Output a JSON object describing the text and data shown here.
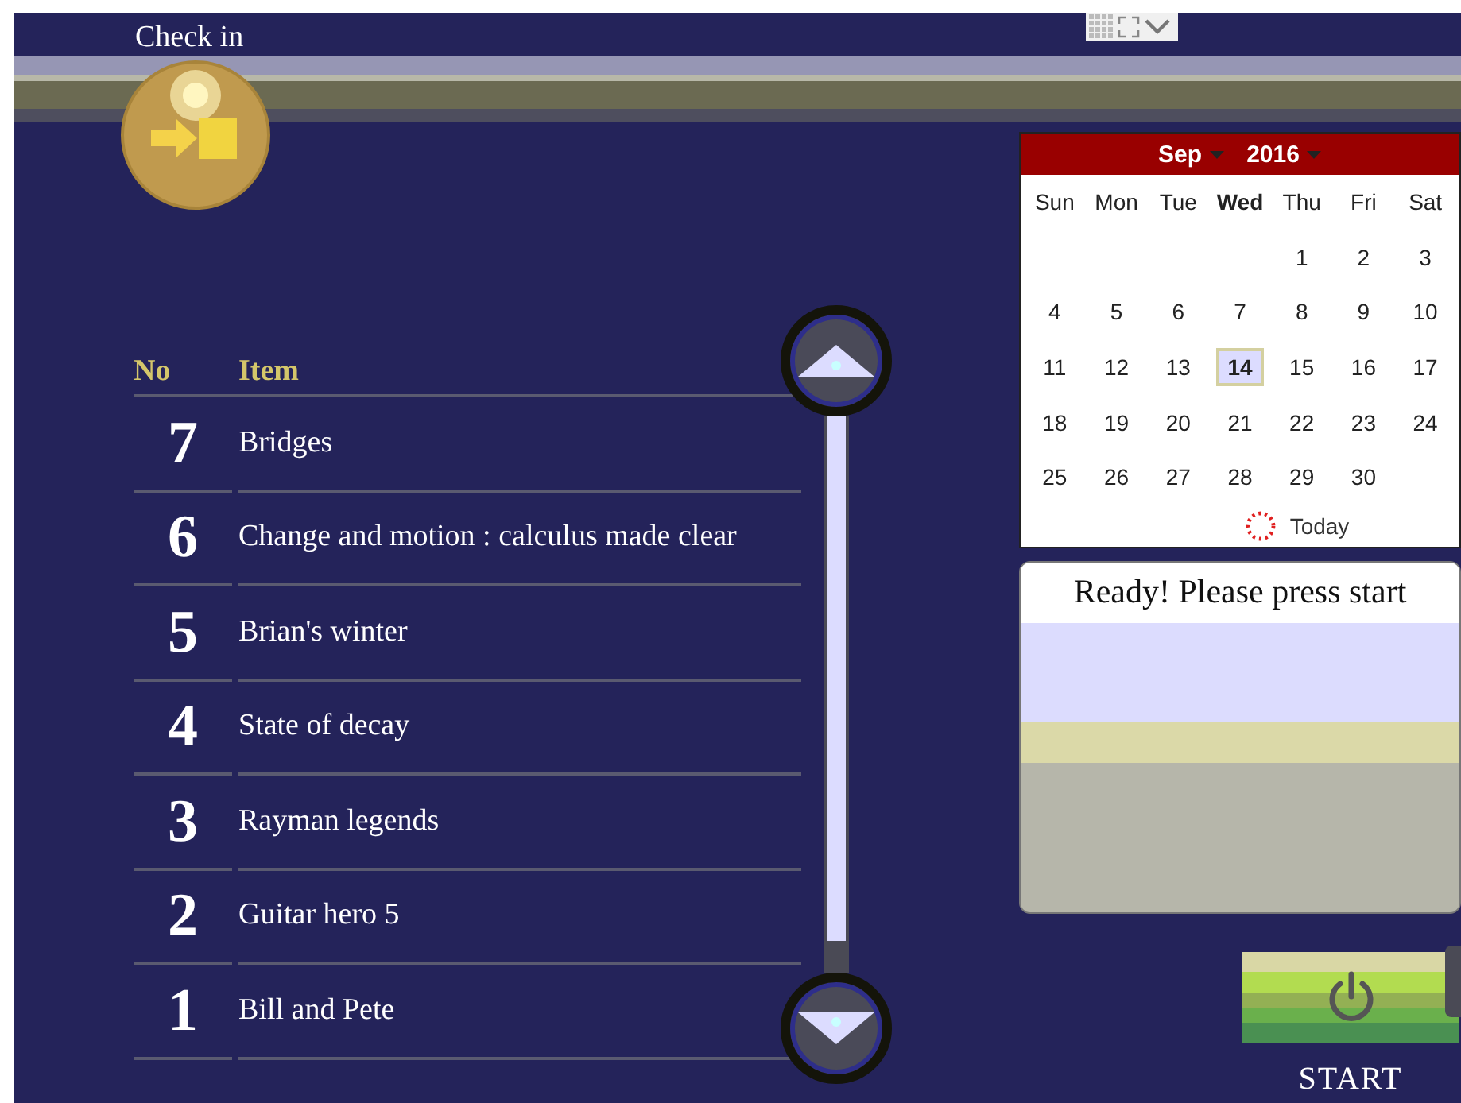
{
  "window": {
    "title": "Check in"
  },
  "list": {
    "columns": [
      "No",
      "Item"
    ],
    "rows": [
      {
        "no": "7",
        "item": "Bridges"
      },
      {
        "no": "6",
        "item": "Change and motion : calculus made clear"
      },
      {
        "no": "5",
        "item": "Brian's winter"
      },
      {
        "no": "4",
        "item": "State of decay"
      },
      {
        "no": "3",
        "item": "Rayman legends"
      },
      {
        "no": "2",
        "item": "Guitar hero 5"
      },
      {
        "no": "1",
        "item": "Bill and Pete"
      }
    ]
  },
  "calendar": {
    "month": "Sep",
    "year": "2016",
    "weekdays": [
      {
        "label": "Sun",
        "current": false
      },
      {
        "label": "Mon",
        "current": false
      },
      {
        "label": "Tue",
        "current": false
      },
      {
        "label": "Wed",
        "current": true
      },
      {
        "label": "Thu",
        "current": false
      },
      {
        "label": "Fri",
        "current": false
      },
      {
        "label": "Sat",
        "current": false
      }
    ],
    "weeks": [
      [
        {
          "label": "1",
          "selected": false
        },
        {
          "label": "2",
          "selected": false
        },
        {
          "label": "3",
          "selected": false
        }
      ],
      [
        {
          "label": "4",
          "selected": false
        },
        {
          "label": "5",
          "selected": false
        },
        {
          "label": "6",
          "selected": false
        },
        {
          "label": "7",
          "selected": false
        },
        {
          "label": "8",
          "selected": false
        },
        {
          "label": "9",
          "selected": false
        },
        {
          "label": "10",
          "selected": false
        }
      ],
      [
        {
          "label": "11",
          "selected": false
        },
        {
          "label": "12",
          "selected": false
        },
        {
          "label": "13",
          "selected": false
        },
        {
          "label": "14",
          "selected": true
        },
        {
          "label": "15",
          "selected": false
        },
        {
          "label": "16",
          "selected": false
        },
        {
          "label": "17",
          "selected": false
        }
      ],
      [
        {
          "label": "18",
          "selected": false
        },
        {
          "label": "19",
          "selected": false
        },
        {
          "label": "20",
          "selected": false
        },
        {
          "label": "21",
          "selected": false
        },
        {
          "label": "22",
          "selected": false
        },
        {
          "label": "23",
          "selected": false
        },
        {
          "label": "24",
          "selected": false
        }
      ],
      [
        {
          "label": "25",
          "selected": false
        },
        {
          "label": "26",
          "selected": false
        },
        {
          "label": "27",
          "selected": false
        },
        {
          "label": "28",
          "selected": false
        },
        {
          "label": "29",
          "selected": false
        },
        {
          "label": "30",
          "selected": false
        }
      ]
    ],
    "today_label": "Today"
  },
  "status": {
    "message": "Ready! Please press start"
  },
  "start_button": {
    "label": "START"
  }
}
